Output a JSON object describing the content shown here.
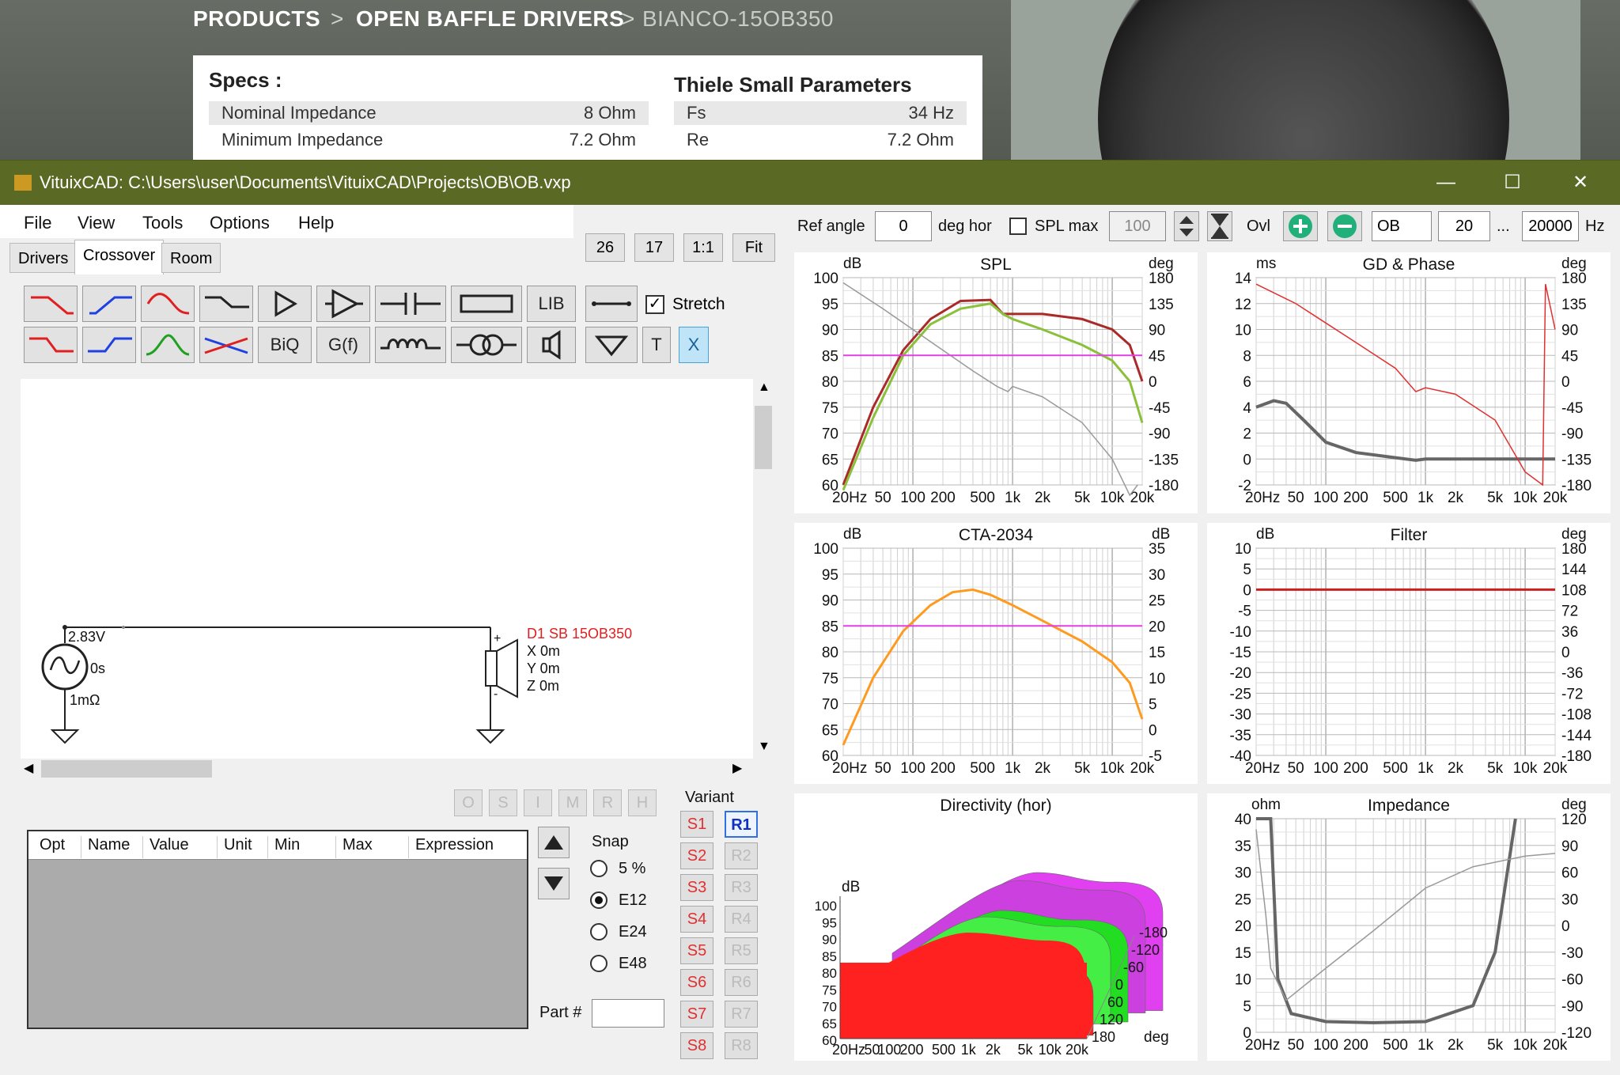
{
  "website": {
    "breadcrumb": {
      "products": "PRODUCTS",
      "sep1": ">",
      "category": "OPEN BAFFLE DRIVERS",
      "sep2": ">",
      "model": "BIANCO-15OB350"
    },
    "specs": {
      "title": "Specs :",
      "rows": [
        {
          "label": "Nominal Impedance",
          "value": "8 Ohm"
        },
        {
          "label": "Minimum Impedance",
          "value": "7.2 Ohm"
        }
      ]
    },
    "ts": {
      "title": "Thiele Small Parameters",
      "rows": [
        {
          "label": "Fs",
          "value": "34 Hz"
        },
        {
          "label": "Re",
          "value": "7.2 Ohm"
        }
      ]
    }
  },
  "window": {
    "title": "VituixCAD: C:\\Users\\user\\Documents\\VituixCAD\\Projects\\OB\\OB.vxp",
    "controls": {
      "minimize": "—",
      "maximize": "☐",
      "close": "✕"
    }
  },
  "menu": {
    "file": "File",
    "view": "View",
    "tools": "Tools",
    "options": "Options",
    "help": "Help"
  },
  "tabs": {
    "drivers": "Drivers",
    "crossover": "Crossover",
    "room": "Room"
  },
  "zoom": {
    "b1": "26",
    "b2": "17",
    "b3": "1:1",
    "b4": "Fit"
  },
  "toolbar": {
    "lib": "LIB",
    "biq": "BiQ",
    "gf": "G(f)",
    "t": "T",
    "x": "X",
    "stretch": "Stretch"
  },
  "schematic": {
    "voltage": "2.83V",
    "delay": "0s",
    "resistance": "1mΩ",
    "driver": "D1 SB 15OB350",
    "x": "X 0m",
    "y": "Y 0m",
    "z": "Z 0m",
    "plus": "+",
    "minus": "-"
  },
  "opt_buttons": [
    "O",
    "S",
    "I",
    "M",
    "R",
    "H"
  ],
  "table": {
    "headers": [
      "Opt",
      "Name",
      "Value",
      "Unit",
      "Min",
      "Max",
      "Expression"
    ]
  },
  "snap": {
    "label": "Snap",
    "options": [
      "5 %",
      "E12",
      "E24",
      "E48"
    ],
    "selected": "E12"
  },
  "part": {
    "label": "Part #",
    "value": ""
  },
  "variant": {
    "label": "Variant",
    "s": [
      "S1",
      "S2",
      "S3",
      "S4",
      "S5",
      "S6",
      "S7",
      "S8"
    ],
    "r": [
      "R1",
      "R2",
      "R3",
      "R4",
      "R5",
      "R6",
      "R7",
      "R8"
    ],
    "selected": "R1"
  },
  "top_controls": {
    "ref_angle_label": "Ref angle",
    "ref_angle_value": "0",
    "deg_hor": "deg hor",
    "spl_max_label": "SPL max",
    "spl_max_value": "100",
    "ovl": "Ovl",
    "name_value": "OB",
    "f_low": "20",
    "dots": "...",
    "f_high": "20000",
    "hz": "Hz"
  },
  "colors": {
    "accent": "#5a6a25",
    "spl_red": "#aa2a2a",
    "spl_green": "#8ac03a",
    "magenta": "#e040e0",
    "orange": "#ff9a20",
    "filter_red": "#cc2020"
  },
  "charts": {
    "spl": {
      "title": "SPL",
      "left_unit": "dB",
      "right_unit": "deg",
      "y": [
        "100",
        "95",
        "90",
        "85",
        "80",
        "75",
        "70",
        "65",
        "60"
      ],
      "yr": [
        "180",
        "135",
        "90",
        "45",
        "0",
        "-45",
        "-90",
        "-135",
        "-180"
      ],
      "x": [
        "20Hz",
        "50",
        "100",
        "200",
        "500",
        "1k",
        "2k",
        "5k",
        "10k",
        "20k"
      ]
    },
    "gd": {
      "title": "GD & Phase",
      "left_unit": "ms",
      "right_unit": "deg",
      "y": [
        "14",
        "12",
        "10",
        "8",
        "6",
        "4",
        "2",
        "0",
        "-2"
      ],
      "yr": [
        "180",
        "135",
        "90",
        "45",
        "0",
        "-45",
        "-90",
        "-135",
        "-180"
      ],
      "x": [
        "20Hz",
        "50",
        "100",
        "200",
        "500",
        "1k",
        "2k",
        "5k",
        "10k",
        "20k"
      ]
    },
    "cta": {
      "title": "CTA-2034",
      "left_unit": "dB",
      "right_unit": "dB",
      "y": [
        "100",
        "95",
        "90",
        "85",
        "80",
        "75",
        "70",
        "65",
        "60"
      ],
      "yr": [
        "35",
        "30",
        "25",
        "20",
        "15",
        "10",
        "5",
        "0",
        "-5"
      ],
      "x": [
        "20Hz",
        "50",
        "100",
        "200",
        "500",
        "1k",
        "2k",
        "5k",
        "10k",
        "20k"
      ]
    },
    "filter": {
      "title": "Filter",
      "left_unit": "dB",
      "right_unit": "deg",
      "y": [
        "10",
        "5",
        "0",
        "-5",
        "-10",
        "-15",
        "-20",
        "-25",
        "-30",
        "-35",
        "-40"
      ],
      "yr": [
        "180",
        "144",
        "108",
        "72",
        "36",
        "0",
        "-36",
        "-72",
        "-108",
        "-144",
        "-180"
      ],
      "x": [
        "20Hz",
        "50",
        "100",
        "200",
        "500",
        "1k",
        "2k",
        "5k",
        "10k",
        "20k"
      ]
    },
    "dir": {
      "title": "Directivity (hor)",
      "left_unit": "dB",
      "right_unit": "deg",
      "y": [
        "100",
        "95",
        "90",
        "85",
        "80",
        "75",
        "70",
        "65",
        "60"
      ],
      "yr": [
        "-180",
        "-120",
        "-60",
        "0",
        "60",
        "120",
        "180"
      ],
      "x": [
        "20Hz",
        "50",
        "100",
        "200",
        "500",
        "1k",
        "2k",
        "5k",
        "10k",
        "20k"
      ]
    },
    "imp": {
      "title": "Impedance",
      "left_unit": "ohm",
      "right_unit": "deg",
      "y": [
        "40",
        "35",
        "30",
        "25",
        "20",
        "15",
        "10",
        "5",
        "0"
      ],
      "yr": [
        "120",
        "90",
        "60",
        "30",
        "0",
        "-30",
        "-60",
        "-90",
        "-120"
      ],
      "x": [
        "20Hz",
        "50",
        "100",
        "200",
        "500",
        "1k",
        "2k",
        "5k",
        "10k",
        "20k"
      ]
    }
  }
}
